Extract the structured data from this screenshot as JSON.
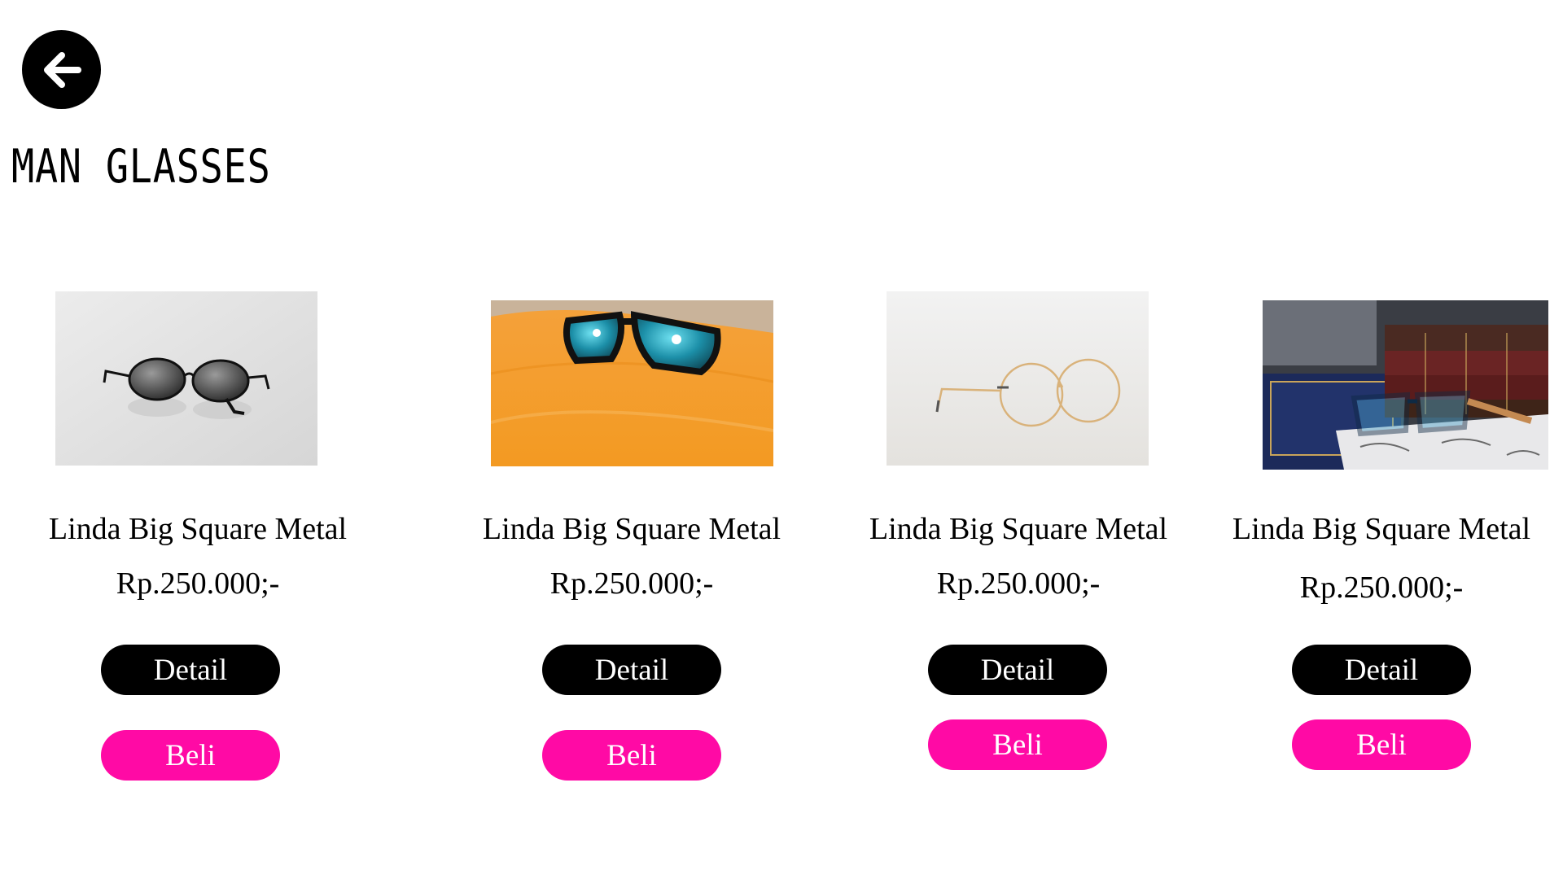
{
  "header": {
    "title": "MAN GLASSES",
    "back_icon": "arrow-left-icon"
  },
  "colors": {
    "detail_button": "#000000",
    "buy_button": "#ff0aa5",
    "background": "#ffffff"
  },
  "products": [
    {
      "name": "Linda Big Square Metal",
      "price": "Rp.250.000;-",
      "detail_label": "Detail",
      "buy_label": "Beli",
      "image": "round-sunglasses-white-background"
    },
    {
      "name": "Linda Big Square Metal",
      "price": "Rp.250.000;-",
      "detail_label": "Detail",
      "buy_label": "Beli",
      "image": "sunglasses-on-orange-towel"
    },
    {
      "name": "Linda Big Square Metal",
      "price": "Rp.250.000;-",
      "detail_label": "Detail",
      "buy_label": "Beli",
      "image": "gold-round-eyeglasses"
    },
    {
      "name": "Linda Big Square Metal",
      "price": "Rp.250.000;-",
      "detail_label": "Detail",
      "buy_label": "Beli",
      "image": "glasses-on-books"
    }
  ]
}
